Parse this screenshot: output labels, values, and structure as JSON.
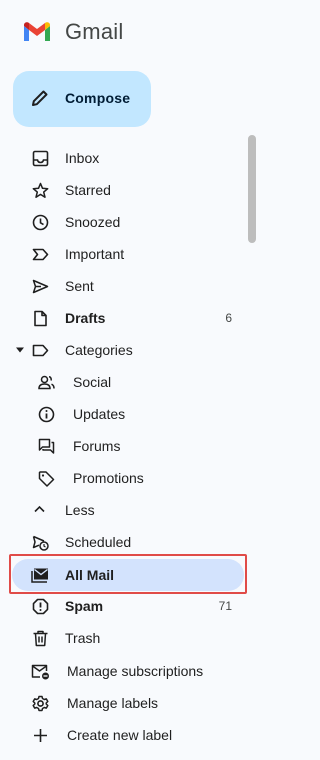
{
  "app": {
    "name": "Gmail"
  },
  "compose": {
    "label": "Compose"
  },
  "nav": {
    "inbox": "Inbox",
    "starred": "Starred",
    "snoozed": "Snoozed",
    "important": "Important",
    "sent": "Sent",
    "drafts": "Drafts",
    "drafts_count": "6",
    "categories": "Categories",
    "social": "Social",
    "updates": "Updates",
    "forums": "Forums",
    "promotions": "Promotions",
    "less": "Less",
    "scheduled": "Scheduled",
    "all_mail": "All Mail",
    "spam": "Spam",
    "spam_count": "71",
    "trash": "Trash",
    "manage_subscriptions": "Manage subscriptions",
    "manage_labels": "Manage labels",
    "create_label": "Create new label"
  },
  "selected_item": "all_mail",
  "colors": {
    "active_bg": "#d3e3fd",
    "compose_bg": "#c2e7ff",
    "highlight_border": "#e04b48"
  }
}
